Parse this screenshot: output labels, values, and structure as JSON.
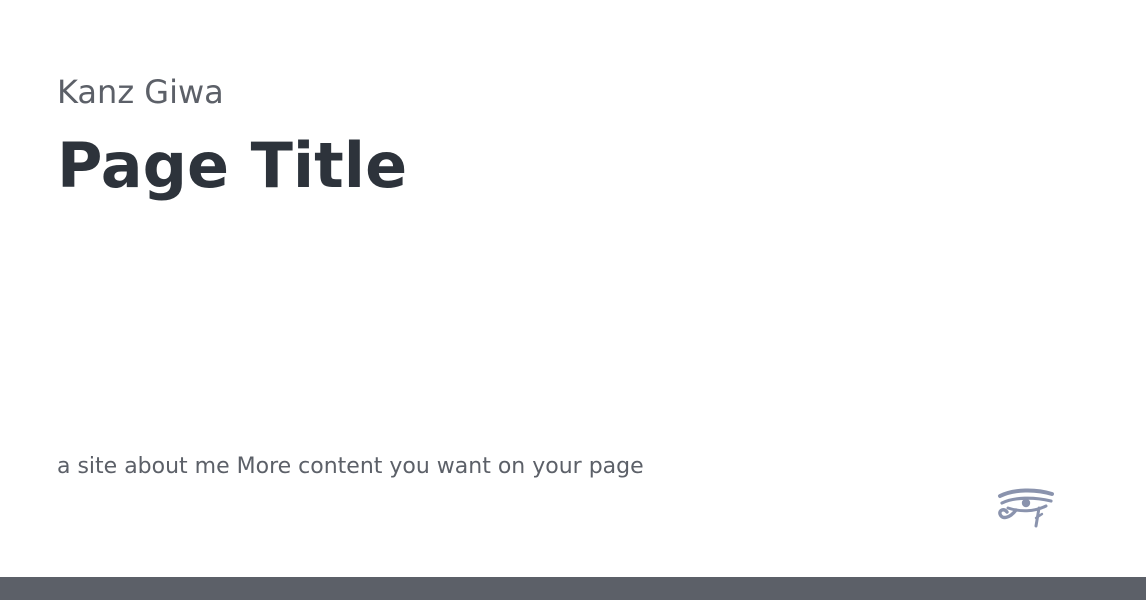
{
  "header": {
    "site_name": "Kanz Giwa",
    "page_title": "Page Title"
  },
  "main": {
    "description": "a site about me More content you want on your page"
  },
  "logo": {
    "icon": "eye-of-horus-icon",
    "color": "#8a93ad"
  },
  "colors": {
    "background": "#ffffff",
    "site_name": "#5c6068",
    "title": "#2d333b",
    "footer_bar": "#5c6068"
  }
}
